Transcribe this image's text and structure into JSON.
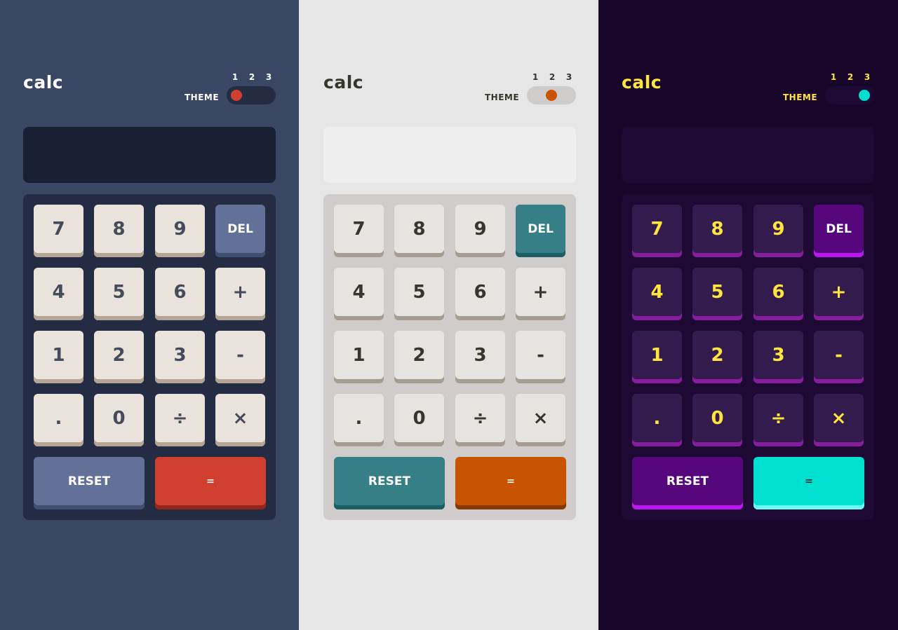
{
  "themes": [
    {
      "logo": "calc",
      "theme_label": "THEME",
      "theme_numbers": [
        "1",
        "2",
        "3"
      ],
      "selected_theme": 1,
      "display_value": "",
      "keys": [
        "7",
        "8",
        "9",
        "DEL",
        "4",
        "5",
        "6",
        "+",
        "1",
        "2",
        "3",
        "-",
        ".",
        "0",
        "÷",
        "×"
      ],
      "reset_label": "RESET",
      "equals_label": "=",
      "colors": {
        "background": "#3a4764",
        "logo": "#ffffff",
        "label": "#ffffff",
        "toggle_bg": "#232c43",
        "knob": "#d03f2f",
        "screen": "#182034",
        "keypad": "#232c43",
        "key": "#eae3dc",
        "key_shadow": "#b4a597",
        "key_text": "#444b5a",
        "del": "#637097",
        "del_shadow": "#404e72",
        "del_text": "#ffffff",
        "equals": "#d03f2f",
        "equals_shadow": "#93261a",
        "equals_text": "#ffffff"
      }
    },
    {
      "logo": "calc",
      "theme_label": "THEME",
      "theme_numbers": [
        "1",
        "2",
        "3"
      ],
      "selected_theme": 2,
      "display_value": "",
      "keys": [
        "7",
        "8",
        "9",
        "DEL",
        "4",
        "5",
        "6",
        "+",
        "1",
        "2",
        "3",
        "-",
        ".",
        "0",
        "÷",
        "×"
      ],
      "reset_label": "RESET",
      "equals_label": "=",
      "colors": {
        "background": "#e6e6e6",
        "logo": "#36362c",
        "label": "#36362c",
        "toggle_bg": "#d1cccc",
        "knob": "#c85402",
        "screen": "#eeeeee",
        "keypad": "#d1cccc",
        "key": "#e5e4e1",
        "key_shadow": "#a69d91",
        "key_text": "#36362c",
        "del": "#377f86",
        "del_shadow": "#1b5f65",
        "del_text": "#ffffff",
        "equals": "#c85402",
        "equals_shadow": "#873901",
        "equals_text": "#ffffff"
      }
    },
    {
      "logo": "calc",
      "theme_label": "THEME",
      "theme_numbers": [
        "1",
        "2",
        "3"
      ],
      "selected_theme": 3,
      "display_value": "",
      "keys": [
        "7",
        "8",
        "9",
        "DEL",
        "4",
        "5",
        "6",
        "+",
        "1",
        "2",
        "3",
        "-",
        ".",
        "0",
        "÷",
        "×"
      ],
      "reset_label": "RESET",
      "equals_label": "=",
      "colors": {
        "background": "#17062a",
        "logo": "#ffe53d",
        "label": "#ffe53d",
        "toggle_bg": "#1d0934",
        "knob": "#00e0d1",
        "screen": "#1d0934",
        "keypad": "#1d0934",
        "key": "#331b4d",
        "key_shadow": "#881c9e",
        "key_text": "#ffe53d",
        "del": "#56077c",
        "del_shadow": "#be15f4",
        "del_text": "#ffffff",
        "equals": "#00e0d1",
        "equals_shadow": "#6cf9f2",
        "equals_text": "#1a2327"
      }
    }
  ]
}
